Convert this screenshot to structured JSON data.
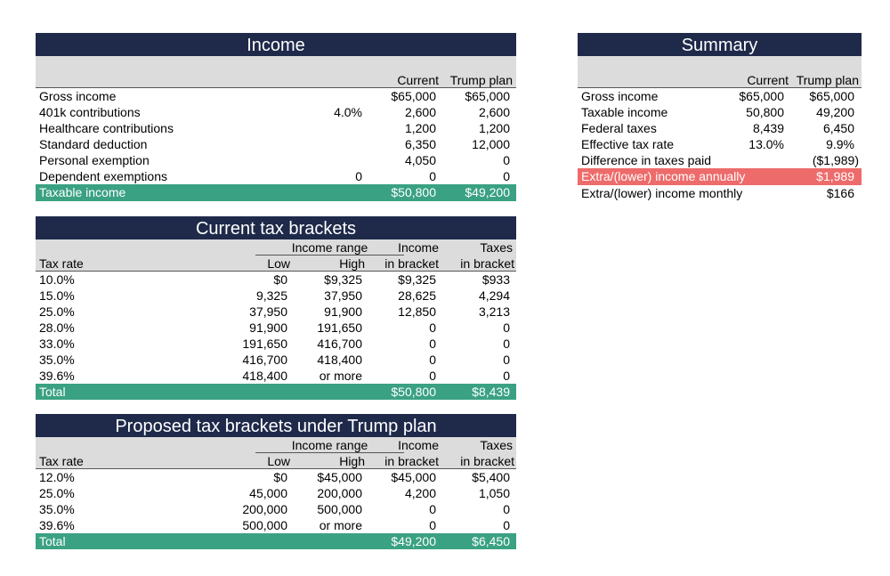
{
  "income": {
    "title": "Income",
    "col_current": "Current",
    "col_trump": "Trump plan",
    "rows": [
      {
        "label": "Gross income",
        "extra": "",
        "current": "$65,000",
        "trump": "$65,000"
      },
      {
        "label": "401k contributions",
        "extra": "4.0%",
        "current": "2,600",
        "trump": "2,600"
      },
      {
        "label": "Healthcare contributions",
        "extra": "",
        "current": "1,200",
        "trump": "1,200"
      },
      {
        "label": "Standard deduction",
        "extra": "",
        "current": "6,350",
        "trump": "12,000"
      },
      {
        "label": "Personal exemption",
        "extra": "",
        "current": "4,050",
        "trump": "0"
      },
      {
        "label": "Dependent exemptions",
        "extra": "0",
        "current": "0",
        "trump": "0"
      }
    ],
    "total": {
      "label": "Taxable income",
      "current": "$50,800",
      "trump": "$49,200"
    }
  },
  "summary": {
    "title": "Summary",
    "col_current": "Current",
    "col_trump": "Trump plan",
    "rows": [
      {
        "label": "Gross income",
        "current": "$65,000",
        "trump": "$65,000"
      },
      {
        "label": "Taxable income",
        "current": "50,800",
        "trump": "49,200"
      },
      {
        "label": "Federal taxes",
        "current": "8,439",
        "trump": "6,450"
      },
      {
        "label": "Effective tax rate",
        "current": "13.0%",
        "trump": "9.9%"
      },
      {
        "label": "Difference in taxes paid",
        "current": "",
        "trump": "($1,989)"
      }
    ],
    "highlight": {
      "label": "Extra/(lower) income annually",
      "value": "$1,989"
    },
    "monthly": {
      "label": "Extra/(lower) income monthly",
      "value": "$166"
    }
  },
  "current_brackets": {
    "title": "Current tax brackets",
    "hdr_income_range": "Income range",
    "hdr_income": "Income",
    "hdr_taxes": "Taxes",
    "hdr_tax_rate": "Tax rate",
    "hdr_low": "Low",
    "hdr_high": "High",
    "hdr_in_bracket_1": "in bracket",
    "hdr_in_bracket_2": "in bracket",
    "rows": [
      {
        "rate": "10.0%",
        "low": "$0",
        "high": "$9,325",
        "income": "$9,325",
        "taxes": "$933"
      },
      {
        "rate": "15.0%",
        "low": "9,325",
        "high": "37,950",
        "income": "28,625",
        "taxes": "4,294"
      },
      {
        "rate": "25.0%",
        "low": "37,950",
        "high": "91,900",
        "income": "12,850",
        "taxes": "3,213"
      },
      {
        "rate": "28.0%",
        "low": "91,900",
        "high": "191,650",
        "income": "0",
        "taxes": "0"
      },
      {
        "rate": "33.0%",
        "low": "191,650",
        "high": "416,700",
        "income": "0",
        "taxes": "0"
      },
      {
        "rate": "35.0%",
        "low": "416,700",
        "high": "418,400",
        "income": "0",
        "taxes": "0"
      },
      {
        "rate": "39.6%",
        "low": "418,400",
        "high": "or more",
        "income": "0",
        "taxes": "0"
      }
    ],
    "total": {
      "label": "Total",
      "income": "$50,800",
      "taxes": "$8,439"
    }
  },
  "proposed_brackets": {
    "title": "Proposed tax brackets under Trump plan",
    "hdr_income_range": "Income range",
    "hdr_income": "Income",
    "hdr_taxes": "Taxes",
    "hdr_tax_rate": "Tax rate",
    "hdr_low": "Low",
    "hdr_high": "High",
    "hdr_in_bracket_1": "in bracket",
    "hdr_in_bracket_2": "in bracket",
    "rows": [
      {
        "rate": "12.0%",
        "low": "$0",
        "high": "$45,000",
        "income": "$45,000",
        "taxes": "$5,400"
      },
      {
        "rate": "25.0%",
        "low": "45,000",
        "high": "200,000",
        "income": "4,200",
        "taxes": "1,050"
      },
      {
        "rate": "35.0%",
        "low": "200,000",
        "high": "500,000",
        "income": "0",
        "taxes": "0"
      },
      {
        "rate": "39.6%",
        "low": "500,000",
        "high": "or more",
        "income": "0",
        "taxes": "0"
      }
    ],
    "total": {
      "label": "Total",
      "income": "$49,200",
      "taxes": "$6,450"
    }
  }
}
